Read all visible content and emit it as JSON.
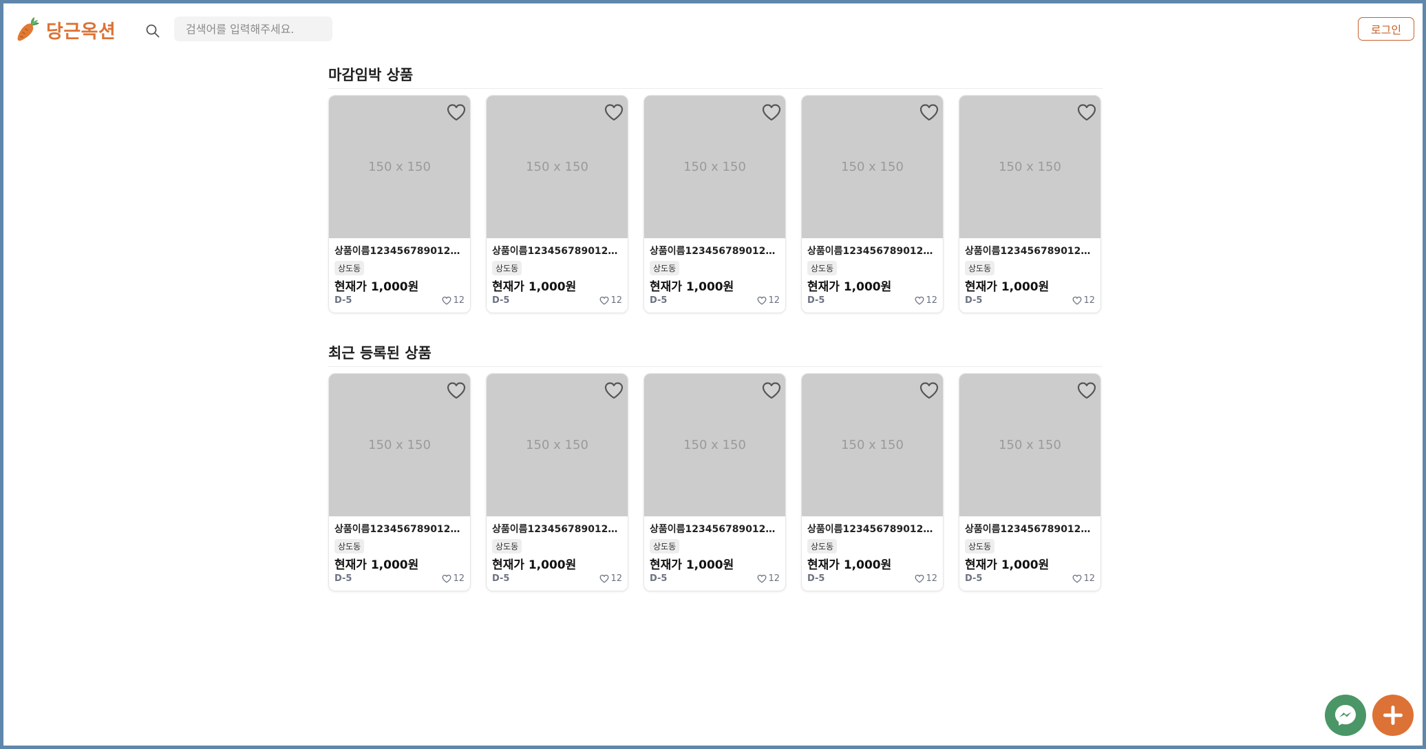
{
  "app": {
    "logo_text": "당근옥션",
    "logo_icon": "carrot-icon",
    "accent_color": "#dc7235",
    "chat_color": "#4b9666"
  },
  "header": {
    "search_icon": "search-icon",
    "search_placeholder": "검색어를 입력해주세요.",
    "login_label": "로그인"
  },
  "sections": [
    {
      "title": "마감임박 상품",
      "items": [
        {
          "image_text": "150 x 150",
          "title": "상품이름12345678901234...",
          "location": "상도동",
          "price": "현재가 1,000원",
          "dday": "D-5",
          "likes": "12"
        },
        {
          "image_text": "150 x 150",
          "title": "상품이름12345678901234...",
          "location": "상도동",
          "price": "현재가 1,000원",
          "dday": "D-5",
          "likes": "12"
        },
        {
          "image_text": "150 x 150",
          "title": "상품이름12345678901234...",
          "location": "상도동",
          "price": "현재가 1,000원",
          "dday": "D-5",
          "likes": "12"
        },
        {
          "image_text": "150 x 150",
          "title": "상품이름12345678901234...",
          "location": "상도동",
          "price": "현재가 1,000원",
          "dday": "D-5",
          "likes": "12"
        },
        {
          "image_text": "150 x 150",
          "title": "상품이름12345678901234...",
          "location": "상도동",
          "price": "현재가 1,000원",
          "dday": "D-5",
          "likes": "12"
        }
      ]
    },
    {
      "title": "최근 등록된 상품",
      "items": [
        {
          "image_text": "150 x 150",
          "title": "상품이름12345678901234...",
          "location": "상도동",
          "price": "현재가 1,000원",
          "dday": "D-5",
          "likes": "12"
        },
        {
          "image_text": "150 x 150",
          "title": "상품이름12345678901234...",
          "location": "상도동",
          "price": "현재가 1,000원",
          "dday": "D-5",
          "likes": "12"
        },
        {
          "image_text": "150 x 150",
          "title": "상품이름12345678901234...",
          "location": "상도동",
          "price": "현재가 1,000원",
          "dday": "D-5",
          "likes": "12"
        },
        {
          "image_text": "150 x 150",
          "title": "상품이름12345678901234...",
          "location": "상도동",
          "price": "현재가 1,000원",
          "dday": "D-5",
          "likes": "12"
        },
        {
          "image_text": "150 x 150",
          "title": "상품이름12345678901234...",
          "location": "상도동",
          "price": "현재가 1,000원",
          "dday": "D-5",
          "likes": "12"
        }
      ]
    }
  ],
  "fabs": {
    "chat_icon": "messenger-icon",
    "add_icon": "plus-icon"
  }
}
